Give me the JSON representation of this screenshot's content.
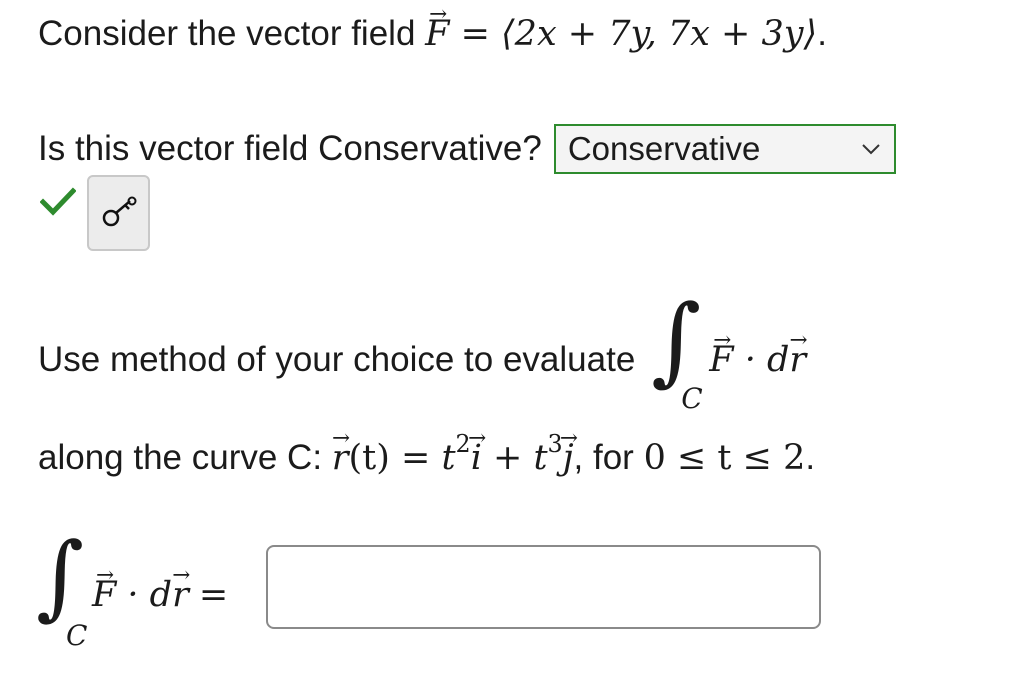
{
  "question1": {
    "prefix": "Consider the vector field ",
    "field_symbol": "F",
    "equals": " = ",
    "field_expression": "⟨2x + 7y, 7x + 3y⟩",
    "suffix": "."
  },
  "question2": {
    "prompt": "Is this vector field Conservative?",
    "select_value": "Conservative"
  },
  "status": {
    "icon": "checkmark-icon",
    "color": "#2e8b2e"
  },
  "key_button": {
    "icon": "key-icon"
  },
  "question3": {
    "prompt": "Use method of your choice to evaluate",
    "integral_sub": "C",
    "integrand_F": "F",
    "integrand_dot": " · d",
    "integrand_r": "r"
  },
  "question4": {
    "prefix": "along the curve C: ",
    "r": "r",
    "t_arg": "(t)",
    "eq": " = ",
    "t1": "t",
    "exp1": "2",
    "i": "i",
    "plus": " + ",
    "t2": "t",
    "exp2": "3",
    "j": "j",
    "comma": ", for ",
    "range": "0 ≤ t ≤ 2",
    "period": "."
  },
  "answer": {
    "integral_sub": "C",
    "integrand_F": "F",
    "integrand_dot": " · d",
    "integrand_r": "r",
    "equals": "=",
    "value": ""
  }
}
